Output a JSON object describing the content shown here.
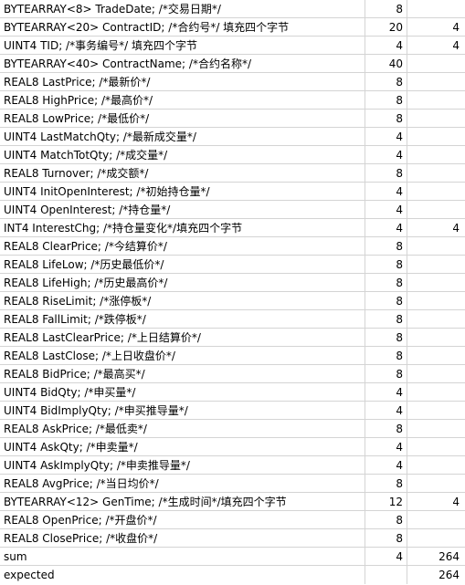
{
  "rows": [
    {
      "label": "BYTEARRAY<8> TradeDate; /*交易日期*/",
      "size": "8",
      "pad": ""
    },
    {
      "label": "BYTEARRAY<20> ContractID; /*合约号*/ 填充四个字节",
      "size": "20",
      "pad": "4"
    },
    {
      "label": "UINT4 TID; /*事务编号*/ 填充四个字节",
      "size": "4",
      "pad": "4"
    },
    {
      "label": "BYTEARRAY<40> ContractName; /*合约名称*/",
      "size": "40",
      "pad": ""
    },
    {
      "label": "REAL8 LastPrice; /*最新价*/",
      "size": "8",
      "pad": ""
    },
    {
      "label": "REAL8 HighPrice; /*最高价*/",
      "size": "8",
      "pad": ""
    },
    {
      "label": "REAL8 LowPrice; /*最低价*/",
      "size": "8",
      "pad": ""
    },
    {
      "label": "UINT4 LastMatchQty; /*最新成交量*/",
      "size": "4",
      "pad": ""
    },
    {
      "label": "UINT4 MatchTotQty; /*成交量*/",
      "size": "4",
      "pad": ""
    },
    {
      "label": "REAL8 Turnover; /*成交额*/",
      "size": "8",
      "pad": ""
    },
    {
      "label": "UINT4 InitOpenInterest; /*初始持仓量*/",
      "size": "4",
      "pad": ""
    },
    {
      "label": "UINT4 OpenInterest; /*持仓量*/",
      "size": "4",
      "pad": ""
    },
    {
      "label": "INT4 InterestChg; /*持仓量变化*/填充四个字节",
      "size": "4",
      "pad": "4"
    },
    {
      "label": "REAL8 ClearPrice; /*今结算价*/",
      "size": "8",
      "pad": ""
    },
    {
      "label": "REAL8 LifeLow; /*历史最低价*/",
      "size": "8",
      "pad": ""
    },
    {
      "label": "REAL8 LifeHigh; /*历史最高价*/",
      "size": "8",
      "pad": ""
    },
    {
      "label": "REAL8 RiseLimit; /*涨停板*/",
      "size": "8",
      "pad": ""
    },
    {
      "label": "REAL8 FallLimit; /*跌停板*/",
      "size": "8",
      "pad": ""
    },
    {
      "label": "REAL8 LastClearPrice; /*上日结算价*/",
      "size": "8",
      "pad": ""
    },
    {
      "label": "REAL8 LastClose; /*上日收盘价*/",
      "size": "8",
      "pad": ""
    },
    {
      "label": "REAL8 BidPrice; /*最高买*/",
      "size": "8",
      "pad": ""
    },
    {
      "label": "UINT4 BidQty; /*申买量*/",
      "size": "4",
      "pad": ""
    },
    {
      "label": "UINT4 BidImplyQty; /*申买推导量*/",
      "size": "4",
      "pad": ""
    },
    {
      "label": "REAL8 AskPrice; /*最低卖*/",
      "size": "8",
      "pad": ""
    },
    {
      "label": "UINT4 AskQty; /*申卖量*/",
      "size": "4",
      "pad": ""
    },
    {
      "label": "UINT4 AskImplyQty; /*申卖推导量*/",
      "size": "4",
      "pad": ""
    },
    {
      "label": "REAL8 AvgPrice; /*当日均价*/",
      "size": "8",
      "pad": ""
    },
    {
      "label": "BYTEARRAY<12> GenTime; /*生成时间*/填充四个字节",
      "size": "12",
      "pad": "4"
    },
    {
      "label": "REAL8 OpenPrice; /*开盘价*/",
      "size": "8",
      "pad": ""
    },
    {
      "label": "REAL8 ClosePrice; /*收盘价*/",
      "size": "8",
      "pad": ""
    },
    {
      "label": "sum",
      "size": "4",
      "pad": "264"
    },
    {
      "label": "expected",
      "size": "",
      "pad": "264"
    }
  ]
}
